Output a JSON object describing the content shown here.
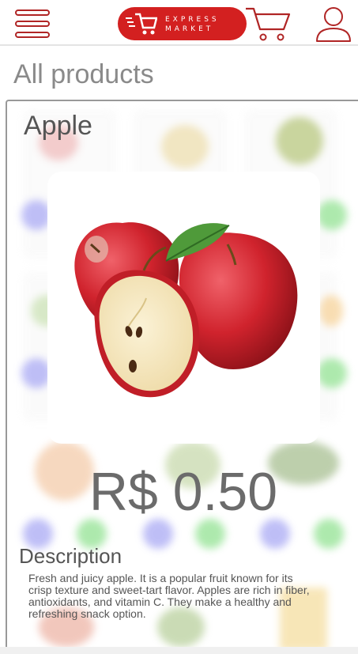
{
  "header": {
    "logo_line1": "EXPRESS",
    "logo_line2": "MARKET",
    "icons": [
      "menu-icon",
      "cart-icon",
      "user-icon"
    ],
    "brand_color": "#d32020"
  },
  "page": {
    "title": "All products"
  },
  "product": {
    "name": "Apple",
    "price": "R$ 0.50",
    "description_title": "Description",
    "description": "Fresh and juicy apple. It is a popular fruit known for its crisp texture and sweet-tart flavor. Apples are rich in fiber, antioxidants, and vitamin C. They make a healthy and refreshing snack option."
  }
}
